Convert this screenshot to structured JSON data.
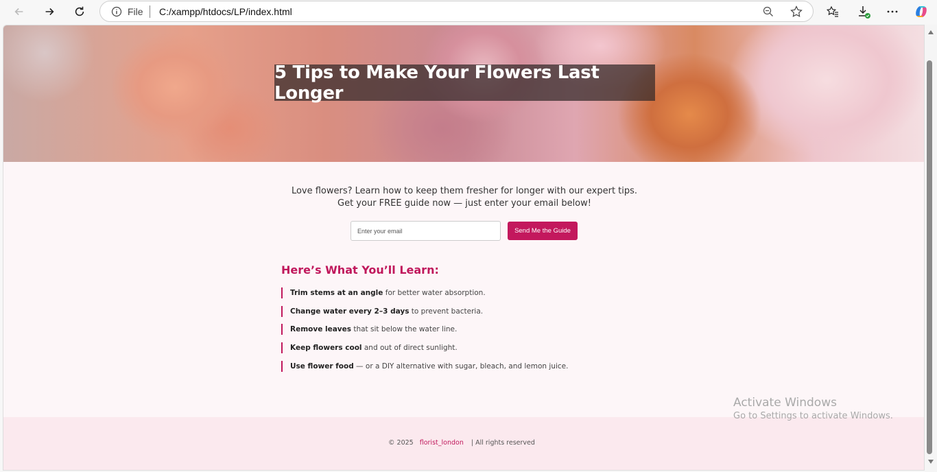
{
  "browser": {
    "file_label": "File",
    "url": "C:/xampp/htdocs/LP/index.html"
  },
  "hero": {
    "title": "5 Tips to Make Your Flowers Last Longer"
  },
  "intro": {
    "line1": "Love flowers? Learn how to keep them fresher for longer with our expert tips.",
    "line2": "Get your FREE guide now — just enter your email below!"
  },
  "signup": {
    "email_placeholder": "Enter your email",
    "button_label": "Send Me the Guide"
  },
  "learn": {
    "heading": "Here’s What You’ll Learn:",
    "tips": [
      {
        "bold": "Trim stems at an angle",
        "rest": " for better water absorption."
      },
      {
        "bold": "Change water every 2–3 days",
        "rest": " to prevent bacteria."
      },
      {
        "bold": "Remove leaves",
        "rest": " that sit below the water line."
      },
      {
        "bold": "Keep flowers cool",
        "rest": " and out of direct sunlight."
      },
      {
        "bold": "Use flower food",
        "rest": " — or a DIY alternative with sugar, bleach, and lemon juice."
      }
    ]
  },
  "footer": {
    "copyright": "© 2025",
    "brand": "florist_london",
    "rights": "| All rights reserved"
  },
  "watermark": {
    "line1": "Activate Windows",
    "line2": "Go to Settings to activate Windows."
  },
  "colors": {
    "accent": "#c3185d",
    "page_bg": "#fdf6f8",
    "footer_bg": "#fbe9ee"
  }
}
